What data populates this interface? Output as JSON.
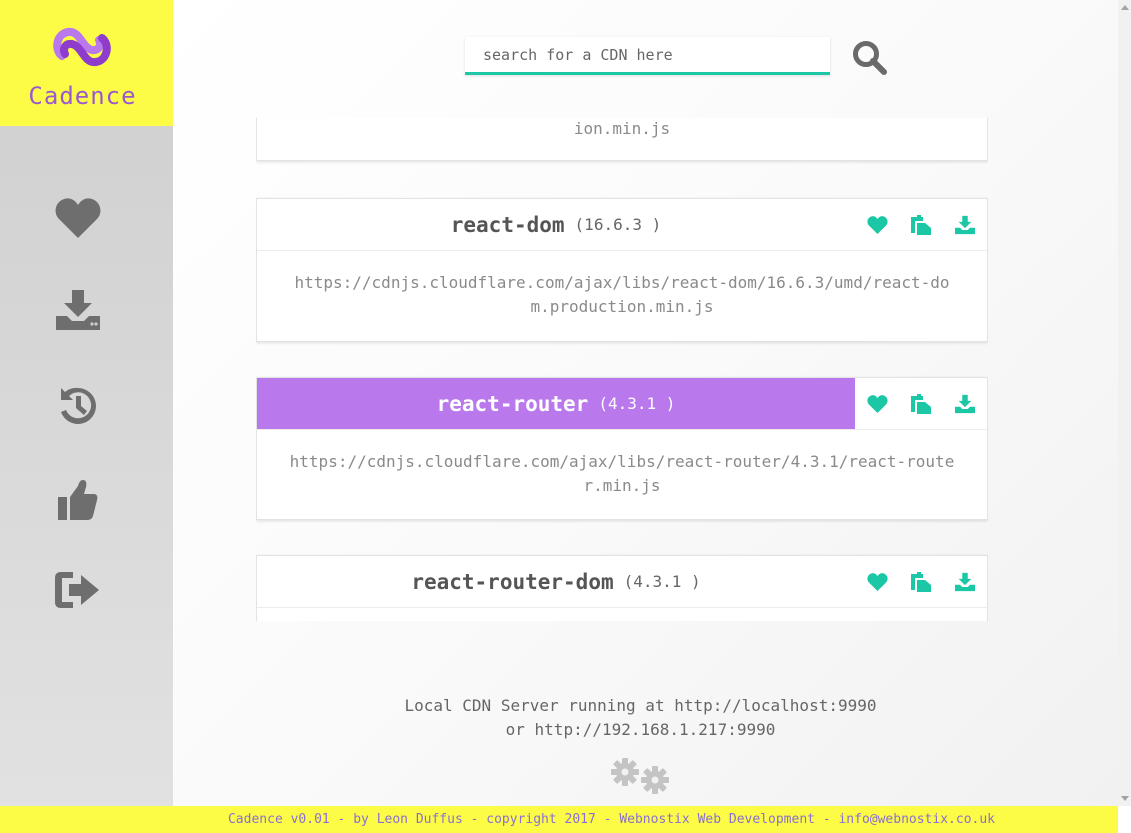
{
  "app": {
    "name": "Cadence"
  },
  "colors": {
    "accent_yellow": "#fcfc46",
    "accent_purple": "#b978ec",
    "accent_teal": "#1bc7a4",
    "logo_purple": "#9b59d0"
  },
  "sidebar": {
    "items": [
      {
        "icon": "heart-icon",
        "label": "favourites"
      },
      {
        "icon": "download-icon",
        "label": "downloads"
      },
      {
        "icon": "history-icon",
        "label": "history"
      },
      {
        "icon": "thumbs-up-icon",
        "label": "popular"
      },
      {
        "icon": "sign-out-icon",
        "label": "exit"
      }
    ]
  },
  "search": {
    "placeholder": "search for a CDN here",
    "value": ""
  },
  "cdn_list": [
    {
      "name": "",
      "version": "",
      "url": "ion.min.js",
      "partial": true
    },
    {
      "name": "react-dom",
      "version": "(16.6.3 )",
      "url": "https://cdnjs.cloudflare.com/ajax/libs/react-dom/16.6.3/umd/react-dom.production.min.js"
    },
    {
      "name": "react-router",
      "version": "(4.3.1 )",
      "url": "https://cdnjs.cloudflare.com/ajax/libs/react-router/4.3.1/react-router.min.js",
      "selected": true
    },
    {
      "name": "react-router-dom",
      "version": "(4.3.1 )",
      "url": ""
    }
  ],
  "status": {
    "line1": "Local CDN Server running at http://localhost:9990",
    "line2": "or http://192.168.1.217:9990"
  },
  "footer": {
    "text": "Cadence v0.01 - by Leon Duffus - copyright 2017 - Webnostix Web Development - info@webnostix.co.uk"
  }
}
